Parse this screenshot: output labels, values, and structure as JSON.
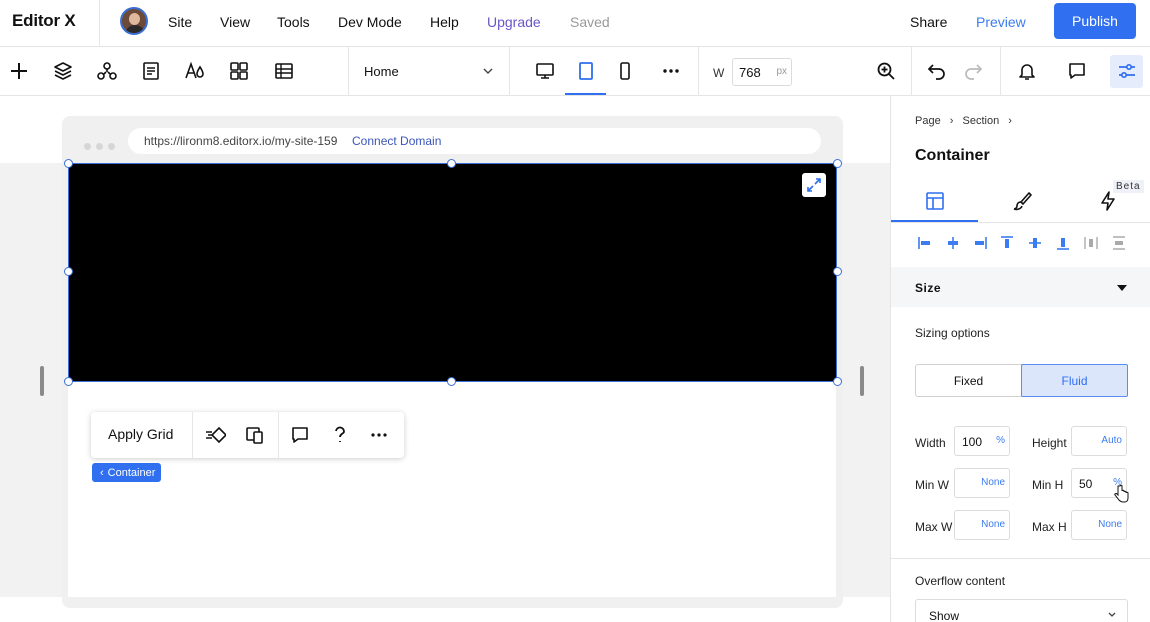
{
  "app": {
    "logo": "Editor X"
  },
  "topbar": {
    "menu": [
      "Site",
      "View",
      "Tools",
      "Dev Mode",
      "Help"
    ],
    "upgrade": "Upgrade",
    "saved": "Saved",
    "share": "Share",
    "preview": "Preview",
    "publish": "Publish"
  },
  "toolbar": {
    "page": "Home",
    "width_label": "W",
    "width_value": "768",
    "width_unit": "px"
  },
  "canvas": {
    "url": "https://lironm8.editorx.io/my-site-159",
    "connect_domain": "Connect Domain",
    "floating": {
      "apply_grid": "Apply Grid"
    },
    "selection_tag": "Container"
  },
  "panel": {
    "breadcrumb": [
      "Page",
      "Section"
    ],
    "title": "Container",
    "beta": "Beta",
    "size_header": "Size",
    "sizing_options": "Sizing options",
    "sizing": {
      "fixed": "Fixed",
      "fluid": "Fluid"
    },
    "fields": {
      "width": {
        "label": "Width",
        "value": "100",
        "unit": "%"
      },
      "height": {
        "label": "Height",
        "value": "Auto"
      },
      "min_w": {
        "label": "Min W",
        "value": "None"
      },
      "min_h": {
        "label": "Min H",
        "value": "50",
        "unit": "%"
      },
      "max_w": {
        "label": "Max W",
        "value": "None"
      },
      "max_h": {
        "label": "Max H",
        "value": "None"
      }
    },
    "overflow_label": "Overflow content",
    "overflow_value": "Show"
  },
  "colors": {
    "accent": "#2f6ff0",
    "upgrade": "#6b55c9"
  }
}
